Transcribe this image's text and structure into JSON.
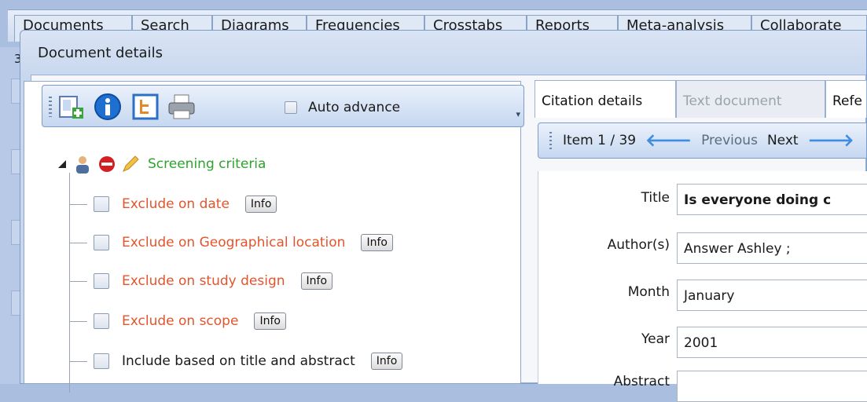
{
  "background_tabs": [
    "Documents",
    "Search",
    "Diagrams",
    "Frequencies",
    "Crosstabs",
    "Reports",
    "Meta-analysis",
    "Collaborate"
  ],
  "background_marker": "3",
  "dialog": {
    "title": "Document details"
  },
  "toolbar": {
    "icons": [
      "add-document-icon",
      "info-icon",
      "tree-view-icon",
      "print-icon"
    ],
    "auto_advance_label": "Auto advance",
    "auto_advance_checked": false
  },
  "tree": {
    "root_label": "Screening criteria",
    "root_icons": [
      "user-icon",
      "stop-icon",
      "edit-icon"
    ],
    "items": [
      {
        "label": "Exclude on date",
        "info": "Info",
        "checked": false,
        "color": "#e2552c"
      },
      {
        "label": "Exclude on Geographical location",
        "info": "Info",
        "checked": false,
        "color": "#e2552c"
      },
      {
        "label": "Exclude on study design",
        "info": "Info",
        "checked": false,
        "color": "#e2552c"
      },
      {
        "label": "Exclude on scope",
        "info": "Info",
        "checked": false,
        "color": "#e2552c"
      },
      {
        "label": "Include based on title and abstract",
        "info": "Info",
        "checked": false,
        "color": "#1a1a1a"
      }
    ]
  },
  "right": {
    "tabs": [
      {
        "label": "Citation details",
        "active": true
      },
      {
        "label": "Text document",
        "active": false
      },
      {
        "label": "Refe",
        "active": false
      }
    ],
    "nav": {
      "item_label": "Item 1 / 39",
      "previous": "Previous",
      "next": "Next"
    },
    "fields": [
      {
        "label": "Title",
        "value": "Is everyone doing c",
        "bold": true
      },
      {
        "label": "Author(s)",
        "value": "Answer Ashley ;",
        "bold": false
      },
      {
        "label": "Month",
        "value": "January",
        "bold": false
      },
      {
        "label": "Year",
        "value": "2001",
        "bold": false
      },
      {
        "label": "Abstract",
        "value": "",
        "bold": false
      }
    ]
  }
}
